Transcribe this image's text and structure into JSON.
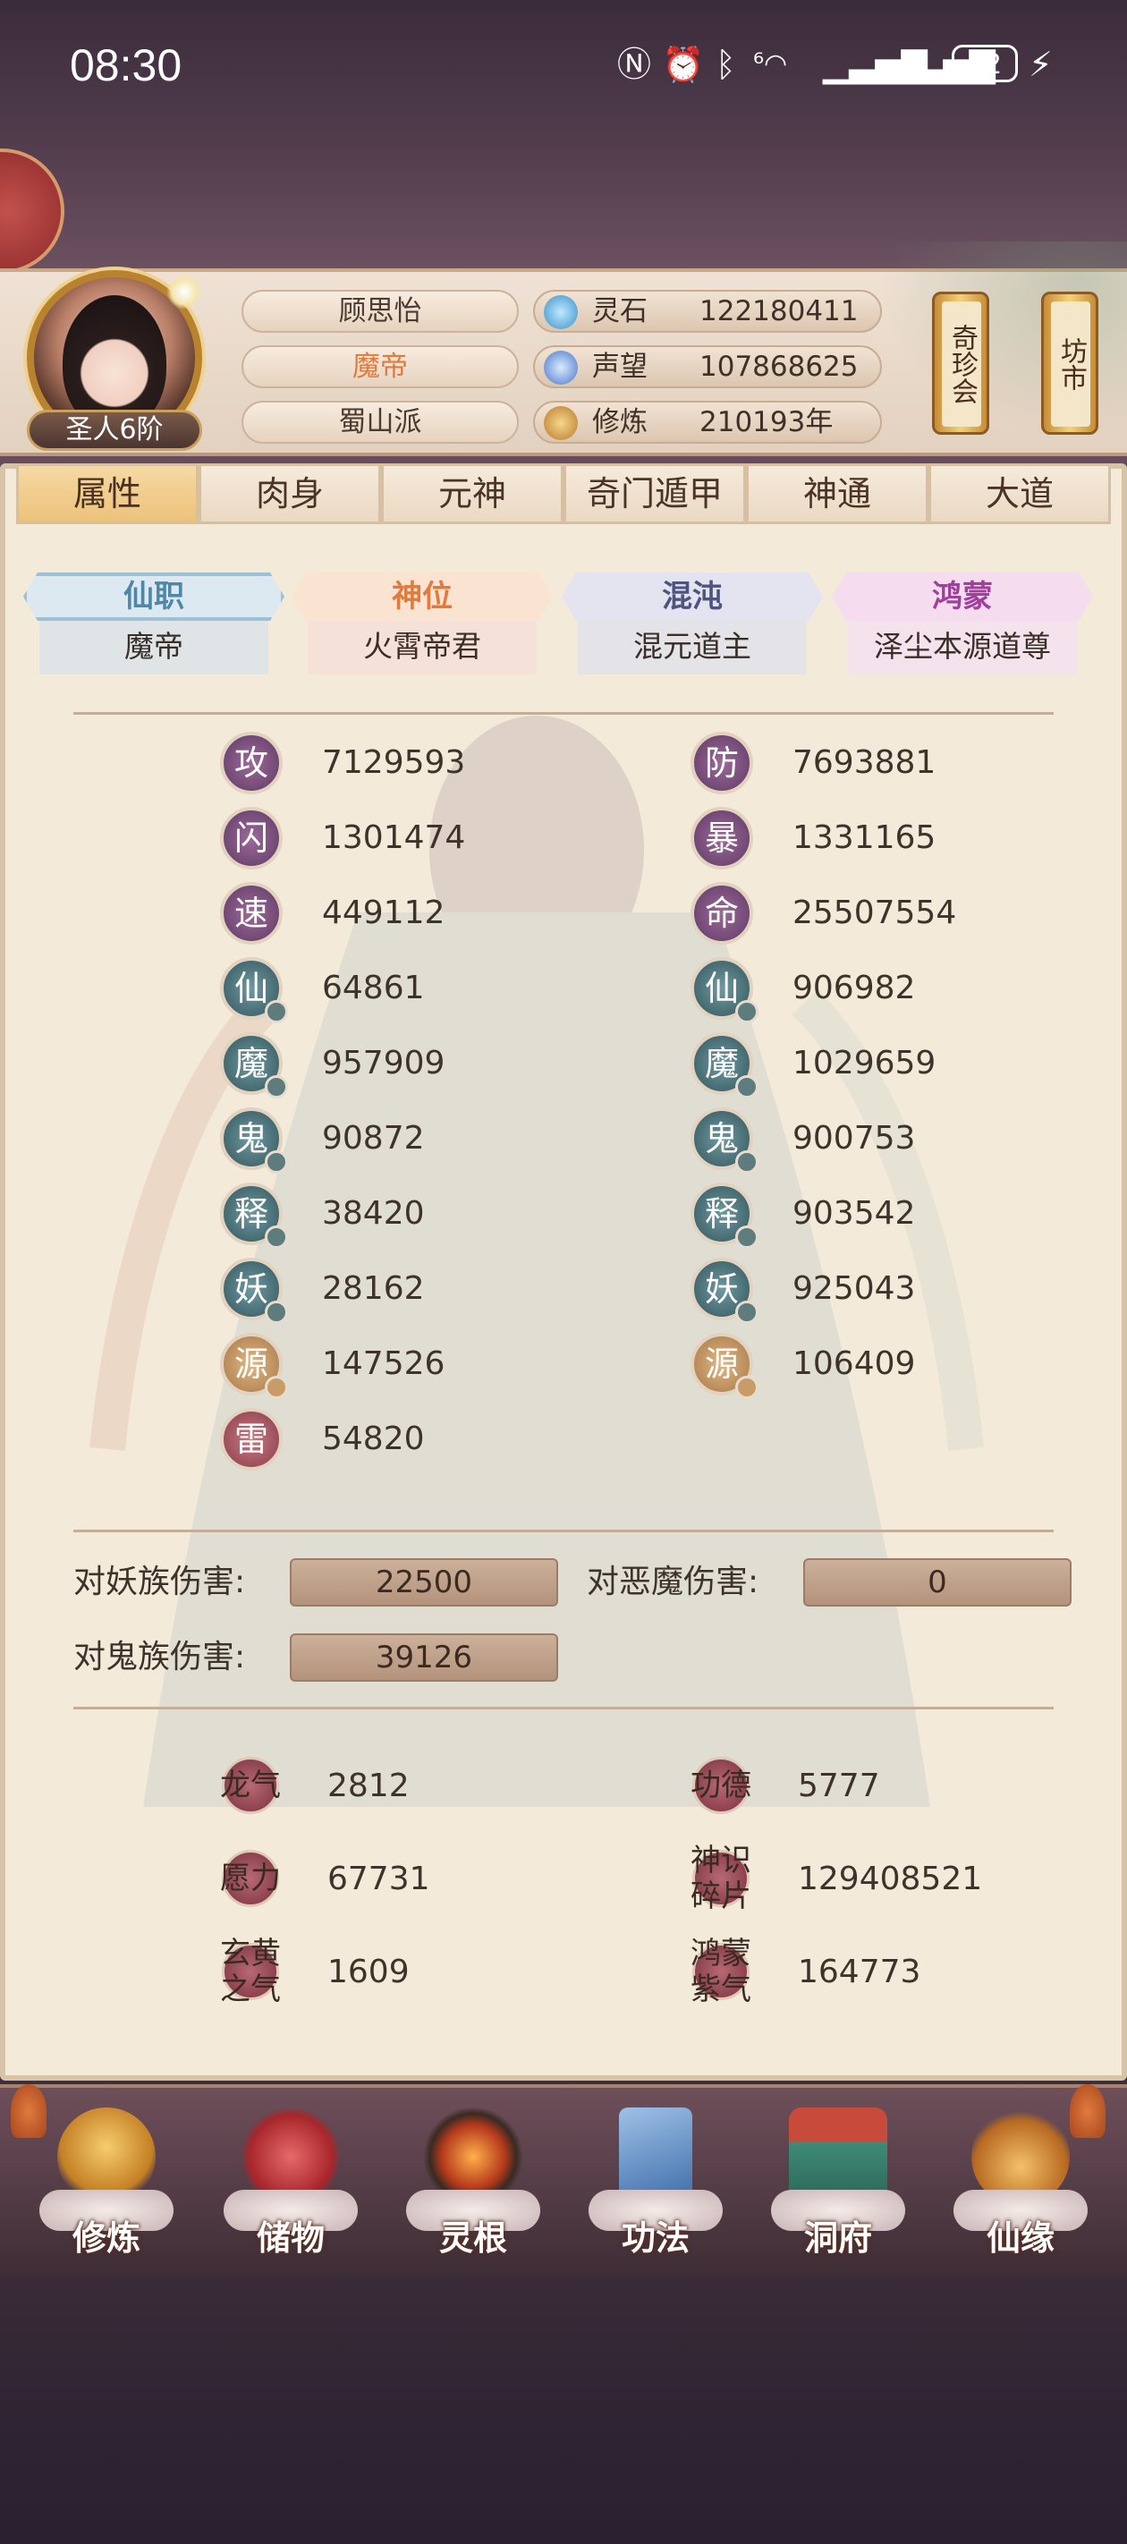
{
  "status_bar": {
    "time": "08:30",
    "battery": "82"
  },
  "profile": {
    "rank_label": "圣人6阶",
    "name": "顾思怡",
    "title": "魔帝",
    "sect": "蜀山派"
  },
  "resources": [
    {
      "label": "灵石",
      "value": "122180411",
      "icon": "spirit-stone-icon"
    },
    {
      "label": "声望",
      "value": "107868625",
      "icon": "reputation-crystal-icon"
    },
    {
      "label": "修炼",
      "value": "210193年",
      "icon": "meditation-icon"
    }
  ],
  "header_buttons": [
    {
      "label": "奇珍会"
    },
    {
      "label": "坊市"
    }
  ],
  "tabs": [
    {
      "label": "属性"
    },
    {
      "label": "肉身"
    },
    {
      "label": "元神"
    },
    {
      "label": "奇门遁甲"
    },
    {
      "label": "神通"
    },
    {
      "label": "大道"
    }
  ],
  "active_tab": "属性",
  "ranks": [
    {
      "title": "仙职",
      "value": "魔帝",
      "color": "#4f87a8"
    },
    {
      "title": "神位",
      "value": "火霄帝君",
      "color": "#e07a3e"
    },
    {
      "title": "混沌",
      "value": "混元道主",
      "color": "#6a6f92"
    },
    {
      "title": "鸿蒙",
      "value": "泽尘本源道尊",
      "color": "#a13f9c"
    }
  ],
  "stats_left": [
    {
      "glyph": "攻",
      "value": "7129593",
      "style": "purple"
    },
    {
      "glyph": "闪",
      "value": "1301474",
      "style": "purple"
    },
    {
      "glyph": "速",
      "value": "449112",
      "style": "purple"
    },
    {
      "glyph": "仙",
      "value": "64861",
      "style": "teal"
    },
    {
      "glyph": "魔",
      "value": "957909",
      "style": "teal"
    },
    {
      "glyph": "鬼",
      "value": "90872",
      "style": "teal"
    },
    {
      "glyph": "释",
      "value": "38420",
      "style": "teal"
    },
    {
      "glyph": "妖",
      "value": "28162",
      "style": "teal"
    },
    {
      "glyph": "源",
      "value": "147526",
      "style": "gold"
    },
    {
      "glyph": "雷",
      "value": "54820",
      "style": "red"
    }
  ],
  "stats_right": [
    {
      "glyph": "防",
      "value": "7693881",
      "style": "purple"
    },
    {
      "glyph": "暴",
      "value": "1331165",
      "style": "purple"
    },
    {
      "glyph": "命",
      "value": "25507554",
      "style": "purple"
    },
    {
      "glyph": "仙",
      "value": "906982",
      "style": "teal"
    },
    {
      "glyph": "魔",
      "value": "1029659",
      "style": "teal"
    },
    {
      "glyph": "鬼",
      "value": "900753",
      "style": "teal"
    },
    {
      "glyph": "释",
      "value": "903542",
      "style": "teal"
    },
    {
      "glyph": "妖",
      "value": "925043",
      "style": "teal"
    },
    {
      "glyph": "源",
      "value": "106409",
      "style": "gold"
    }
  ],
  "damage": [
    {
      "label": "对妖族伤害:",
      "value": "22500"
    },
    {
      "label": "对恶魔伤害:",
      "value": "0"
    },
    {
      "label": "对鬼族伤害:",
      "value": "39126"
    }
  ],
  "currencies": [
    {
      "label": "龙气",
      "value": "2812"
    },
    {
      "label": "功德",
      "value": "5777"
    },
    {
      "label": "愿力",
      "value": "67731"
    },
    {
      "label": "神识碎片",
      "value": "129408521"
    },
    {
      "label": "玄黄之气",
      "value": "1609"
    },
    {
      "label": "鸿蒙紫气",
      "value": "164773"
    }
  ],
  "bottom_nav": [
    {
      "label": "修炼",
      "icon": "cultivation-monk-icon"
    },
    {
      "label": "储物",
      "icon": "storage-bag-icon"
    },
    {
      "label": "灵根",
      "icon": "spirit-root-icon"
    },
    {
      "label": "功法",
      "icon": "technique-book-icon"
    },
    {
      "label": "洞府",
      "icon": "cave-house-icon"
    },
    {
      "label": "仙缘",
      "icon": "immortal-gourd-icon"
    }
  ]
}
